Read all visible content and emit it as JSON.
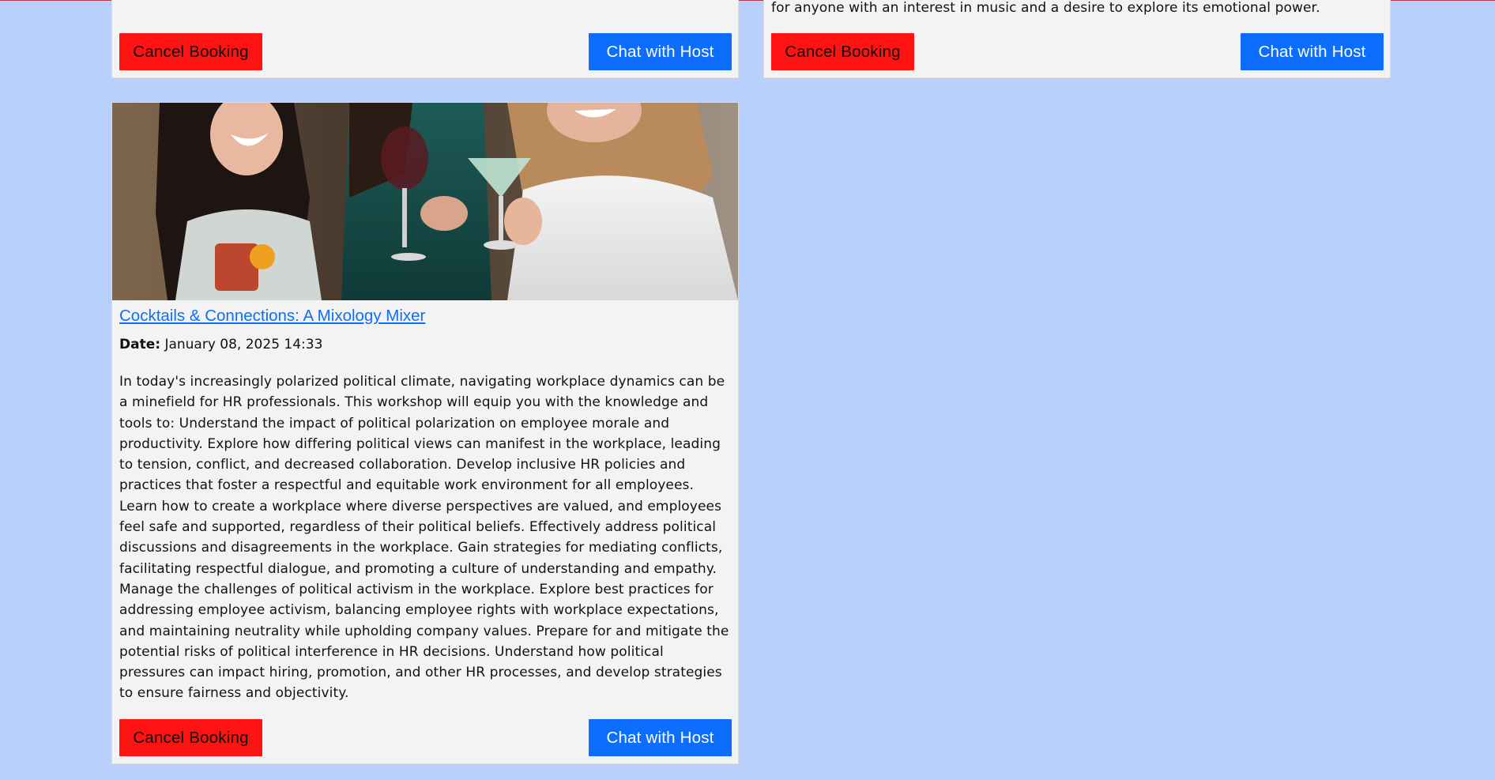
{
  "cards": {
    "top_left": {
      "cancel_label": "Cancel Booking",
      "chat_label": "Chat with Host"
    },
    "top_right": {
      "description_tail": "for anyone with an interest in music and a desire to explore its emotional power.",
      "cancel_label": "Cancel Booking",
      "chat_label": "Chat with Host"
    },
    "main": {
      "title": "Cocktails & Connections: A Mixology Mixer",
      "date_label": "Date:",
      "date_value": "January 08, 2025 14:33",
      "description": "In today's increasingly polarized political climate, navigating workplace dynamics can be a minefield for HR professionals. This workshop will equip you with the knowledge and tools to: Understand the impact of political polarization on employee morale and productivity. Explore how differing political views can manifest in the workplace, leading to tension, conflict, and decreased collaboration. Develop inclusive HR policies and practices that foster a respectful and equitable work environment for all employees. Learn how to create a workplace where diverse perspectives are valued, and employees feel safe and supported, regardless of their political beliefs. Effectively address political discussions and disagreements in the workplace. Gain strategies for mediating conflicts, facilitating respectful dialogue, and promoting a culture of understanding and empathy. Manage the challenges of political activism in the workplace. Explore best practices for addressing employee activism, balancing employee rights with workplace expectations, and maintaining neutrality while upholding company values. Prepare for and mitigate the potential risks of political interference in HR decisions. Understand how political pressures can impact hiring, promotion, and other HR processes, and develop strategies to ensure fairness and objectivity.",
      "cancel_label": "Cancel Booking",
      "chat_label": "Chat with Host"
    }
  },
  "colors": {
    "page_background": "#bad0fc",
    "card_background": "#f3f3f3",
    "cancel_button": "#ff1212",
    "chat_button": "#0d6efd",
    "link": "#0d6efd"
  }
}
